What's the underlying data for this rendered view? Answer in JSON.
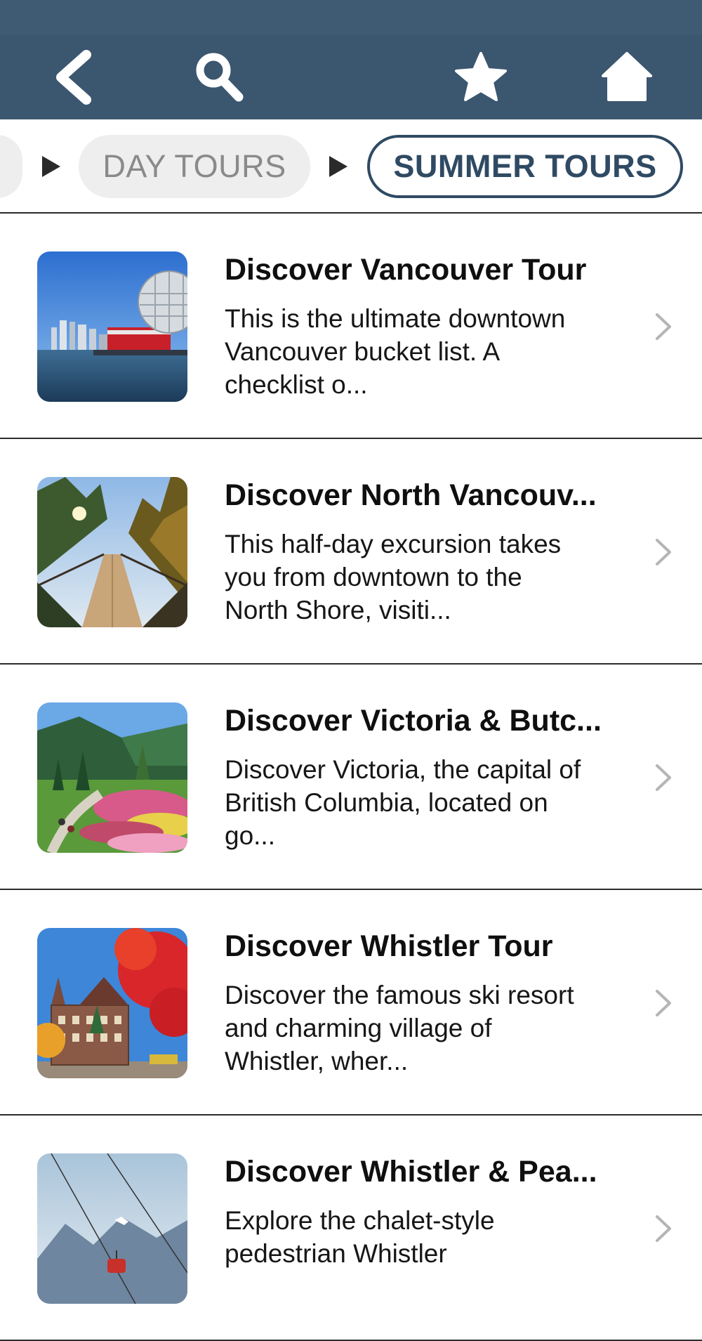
{
  "toolbar": {
    "back_icon": "back-chevron-icon",
    "search_icon": "search-icon",
    "favorite_icon": "star-icon",
    "home_icon": "home-icon",
    "background_color": "#3b566f"
  },
  "breadcrumb": {
    "items": [
      {
        "label": "DAY TOURS",
        "active": false
      },
      {
        "label": "SUMMER TOURS",
        "active": true
      }
    ],
    "active_color": "#2f4a63"
  },
  "tours": [
    {
      "title": "Discover Vancouver Tour",
      "description": "This is the ultimate downtown Vancouver bucket list. A checklist o...",
      "image": "science-world-waterfront-photo"
    },
    {
      "title": "Discover North Vancouv...",
      "description": "This half-day excursion takes you from downtown to the North Shore, visiti...",
      "image": "suspension-bridge-forest-photo"
    },
    {
      "title": "Discover Victoria & Butc...",
      "description": "Discover Victoria, the capital of British Columbia, located on go...",
      "image": "butchart-gardens-photo"
    },
    {
      "title": "Discover Whistler Tour",
      "description": "Discover the famous ski resort and charming village of Whistler, wher...",
      "image": "whistler-village-autumn-photo"
    },
    {
      "title": "Discover Whistler & Pea...",
      "description": "Explore the chalet-style pedestrian Whistler",
      "image": "gondola-mountains-photo"
    }
  ]
}
